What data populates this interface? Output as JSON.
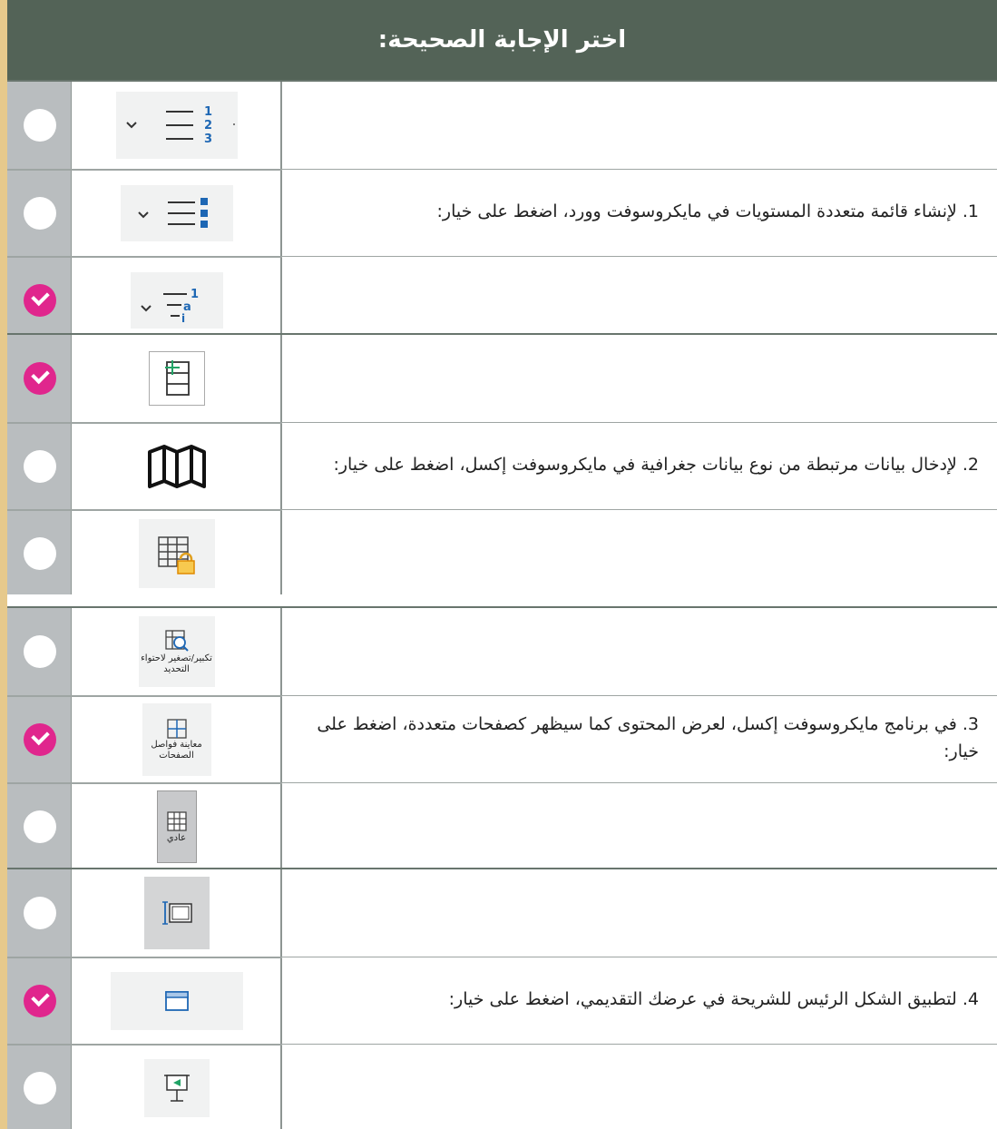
{
  "header": {
    "title": "اختر الإجابة الصحيحة:"
  },
  "colors": {
    "header_bg": "#536357",
    "check": "#e0268d",
    "radio_col": "#b9bdbf",
    "page_edge": "#e6c98c"
  },
  "questions": [
    {
      "text": "1. لإنشاء قائمة متعددة المستويات في مايكروسوفت وورد، اضغط على خيار:",
      "options": [
        {
          "icon": "numbered-list-icon",
          "checked": false
        },
        {
          "icon": "bulleted-list-icon",
          "checked": false
        },
        {
          "icon": "multilevel-list-icon",
          "checked": true
        }
      ]
    },
    {
      "text": "2. لإدخال بيانات مرتبطة من نوع بيانات جغرافية في مايكروسوفت إكسل، اضغط على خيار:",
      "options": [
        {
          "icon": "insert-row-icon",
          "checked": true
        },
        {
          "icon": "map-icon",
          "checked": false
        },
        {
          "icon": "protect-sheet-icon",
          "checked": false
        }
      ]
    },
    {
      "text": "3. في برنامج مايكروسوفت إكسل، لعرض المحتوى كما سيظهر كصفحات متعددة، اضغط على خيار:",
      "options": [
        {
          "icon": "zoom-to-selection-icon",
          "caption": "تكبير/تصغير لاحتواء التحديد",
          "checked": false
        },
        {
          "icon": "page-break-preview-icon",
          "caption": "معاينة فواصل الصفحات",
          "checked": true
        },
        {
          "icon": "normal-view-icon",
          "caption": "عادي",
          "checked": false
        }
      ]
    },
    {
      "text": "4. لتطبيق الشكل الرئيس للشريحة في عرضك التقديمي، اضغط على خيار:",
      "options": [
        {
          "icon": "slide-size-icon",
          "checked": false
        },
        {
          "icon": "slide-master-icon",
          "checked": true
        },
        {
          "icon": "present-slide-icon",
          "checked": false
        }
      ]
    }
  ],
  "numbered_list_digits": [
    "1",
    "2",
    "3"
  ],
  "multilevel_list_marks": [
    "1",
    "a",
    "i"
  ]
}
